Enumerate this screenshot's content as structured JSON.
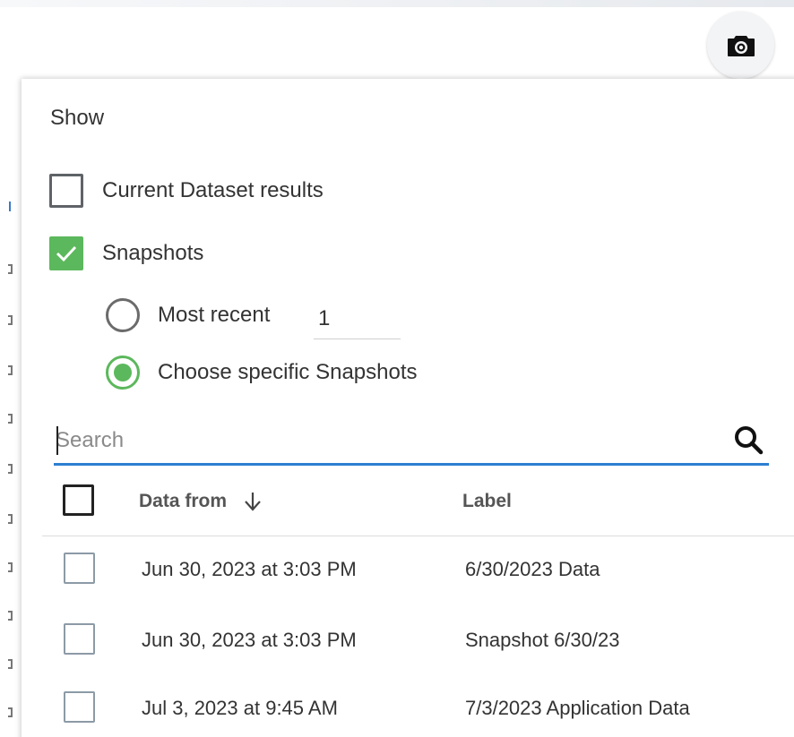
{
  "toolbar": {
    "camera_icon": "camera-icon"
  },
  "panel": {
    "show_label": "Show",
    "current_dataset": {
      "label": "Current Dataset results",
      "checked": false
    },
    "snapshots": {
      "label": "Snapshots",
      "checked": true
    },
    "most_recent": {
      "label": "Most recent",
      "value": "1",
      "selected": false
    },
    "choose_specific": {
      "label": "Choose specific Snapshots",
      "selected": true
    },
    "search": {
      "placeholder": "Search",
      "value": ""
    },
    "table": {
      "headers": {
        "data_from": "Data from",
        "label": "Label",
        "sort": "arrow-down-icon"
      },
      "rows": [
        {
          "data_from": "Jun 30, 2023 at 3:03 PM",
          "label": "6/30/2023 Data",
          "checked": false
        },
        {
          "data_from": "Jun 30, 2023 at 3:03 PM",
          "label": "Snapshot 6/30/23",
          "checked": false
        },
        {
          "data_from": "Jul 3, 2023 at 9:45 AM",
          "label": "7/3/2023 Application Data",
          "checked": false
        }
      ]
    }
  },
  "colors": {
    "accent_green": "#5cb85c",
    "search_underline": "#2d7fd0"
  }
}
